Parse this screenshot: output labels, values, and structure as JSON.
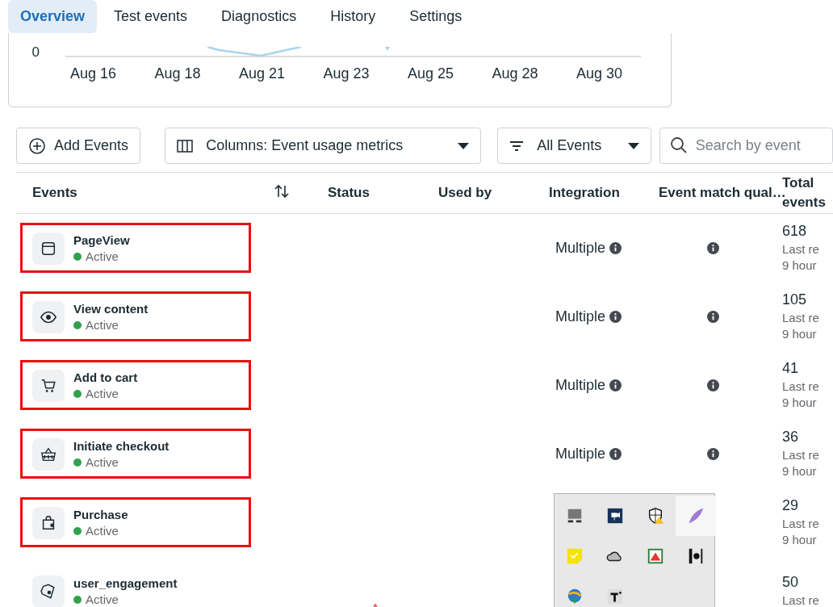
{
  "tabs": [
    {
      "label": "Overview",
      "selected": true
    },
    {
      "label": "Test events",
      "selected": false
    },
    {
      "label": "Diagnostics",
      "selected": false
    },
    {
      "label": "History",
      "selected": false
    },
    {
      "label": "Settings",
      "selected": false
    }
  ],
  "chart": {
    "y_tick": "0",
    "x_labels": [
      "Aug 16",
      "Aug 18",
      "Aug 21",
      "Aug 23",
      "Aug 25",
      "Aug 28",
      "Aug 30"
    ]
  },
  "toolbar": {
    "add_button": "Add Events",
    "columns_dropdown": "Columns: Event usage metrics",
    "filter_dropdown": "All Events",
    "search": {
      "placeholder": "Search by event"
    }
  },
  "table": {
    "columns": [
      "Events",
      "Status",
      "Used by",
      "Integration",
      "Event match qual…",
      "Total events"
    ],
    "rows": [
      {
        "name": "PageView",
        "status": "Active",
        "highlighted": true,
        "warning": false,
        "integration": "Multiple",
        "total": "618",
        "last": "Last re",
        "ago": "9 hour"
      },
      {
        "name": "View content",
        "status": "Active",
        "highlighted": true,
        "warning": false,
        "integration": "Multiple",
        "total": "105",
        "last": "Last re",
        "ago": "9 hour"
      },
      {
        "name": "Add to cart",
        "status": "Active",
        "highlighted": true,
        "warning": false,
        "integration": "Multiple",
        "total": "41",
        "last": "Last re",
        "ago": "9 hour"
      },
      {
        "name": "Initiate checkout",
        "status": "Active",
        "highlighted": true,
        "warning": false,
        "integration": "Multiple",
        "total": "36",
        "last": "Last re",
        "ago": "9 hour"
      },
      {
        "name": "Purchase",
        "status": "Active",
        "highlighted": true,
        "warning": false,
        "total": "29",
        "last": "Last re",
        "ago": "9 hour"
      },
      {
        "name": "user_engagement",
        "status": "Active",
        "highlighted": false,
        "warning": true,
        "total": "50",
        "last": "Last re"
      }
    ]
  },
  "tray": {
    "items": [
      {
        "selected": false
      },
      {
        "selected": false
      },
      {
        "selected": false
      },
      {
        "selected": true
      },
      {
        "selected": false
      },
      {
        "selected": false
      },
      {
        "selected": false
      },
      {
        "selected": false
      },
      {
        "selected": false
      },
      {
        "selected": false
      }
    ]
  }
}
